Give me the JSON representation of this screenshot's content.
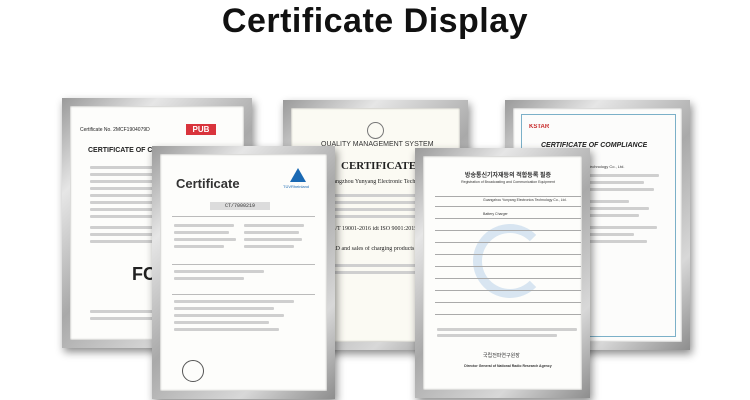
{
  "title": "Certificate Display",
  "certificates": {
    "pub": {
      "number": "Certificate No. 2MCF1904079D",
      "brand": "PUB",
      "heading": "CERTIFICATE OF CONFORMITY",
      "mark": "FC"
    },
    "tuv": {
      "heading": "Certificate",
      "number": "CT/7000219",
      "logo": "TÜVRheinland"
    },
    "qms": {
      "heading": "QUALITY MANAGEMENT SYSTEM",
      "subheading": "CERTIFICATE",
      "company": "Guangzhou Yunyang Electronic Technology Co., Ltd.",
      "standard": "GB/T 19001-2016 idt ISO 9001:2015",
      "scope": "R&D and sales of charging products"
    },
    "kc": {
      "heading_korean": "방송통신기자재등의 적합등록 필증",
      "heading_english": "Registration of Broadcasting and Communication Equipment",
      "company": "Guangzhou Yunyang Electronics Technology Co., Ltd.",
      "product": "Battery Charger",
      "director_korean": "국립전파연구원장",
      "director": "Director General of National Radio Research Agency"
    },
    "compliance": {
      "brand": "KSTAR",
      "heading": "CERTIFICATE OF COMPLIANCE",
      "company": "Guangzhou Yunyang Electronics Technology Co., Ltd."
    }
  },
  "colors": {
    "pub_red": "#d9343c",
    "tuv_blue": "#1a69b3",
    "kc_blue": "#7eb0d6",
    "frame": "#b5b5b5"
  }
}
